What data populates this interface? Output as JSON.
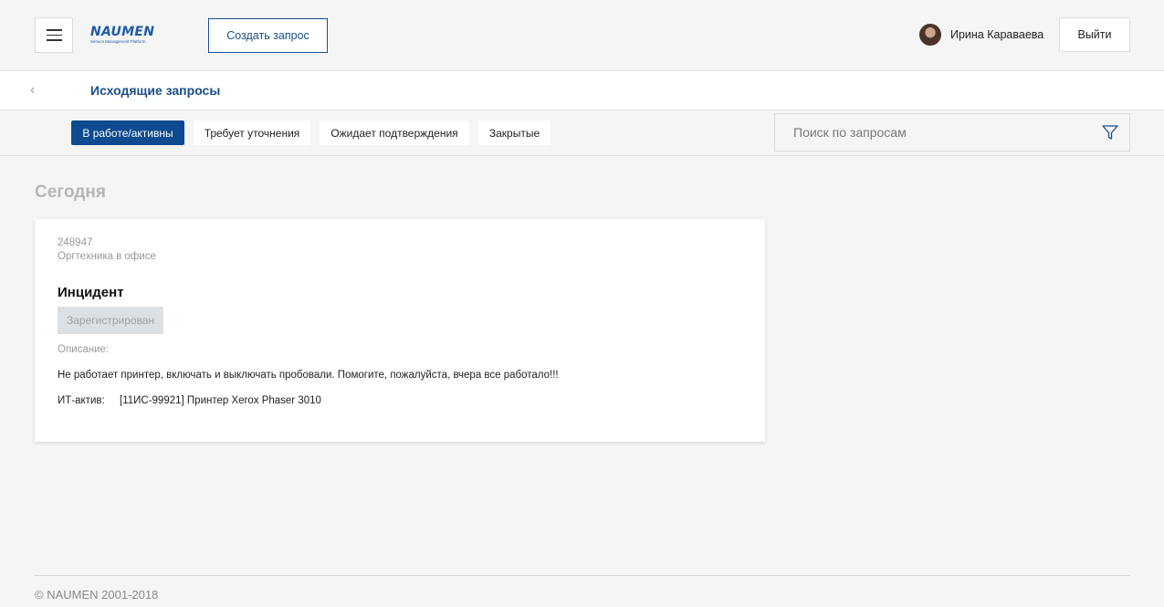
{
  "header": {
    "logo_text": "NAUMEN",
    "logo_tagline": "Service Management Platform",
    "create_label": "Создать запрос",
    "user_name": "Ирина Караваева",
    "logout_label": "Выйти"
  },
  "title_bar": {
    "back_glyph": "‹",
    "title": "Исходящие запросы"
  },
  "filters": {
    "tabs": [
      {
        "label": "В работе/активны",
        "active": true
      },
      {
        "label": "Требует уточнения",
        "active": false
      },
      {
        "label": "Ожидает подтверждения",
        "active": false
      },
      {
        "label": "Закрытые",
        "active": false
      }
    ],
    "search_placeholder": "Поиск по запросам",
    "filter_icon": "funnel-icon"
  },
  "section": {
    "title": "Сегодня"
  },
  "request": {
    "number": "248947",
    "service": "Оргтехника в офисе",
    "type": "Инцидент",
    "status": "Зарегистрирован",
    "description_label": "Описание:",
    "description": "Не работает принтер, включать и выключать пробовали. Помогите, пожалуйста, вчера все работало!!!",
    "asset_label": "ИТ-актив:",
    "asset_value": "[11ИС-99921] Принтер Xerox Phaser 3010"
  },
  "footer": {
    "copyright": "© NAUMEN 2001-2018"
  },
  "colors": {
    "accent": "#0d4a8f",
    "accent_text": "#1a4f8b",
    "background": "#f5f5f5",
    "status_bg": "#dde0e2"
  }
}
